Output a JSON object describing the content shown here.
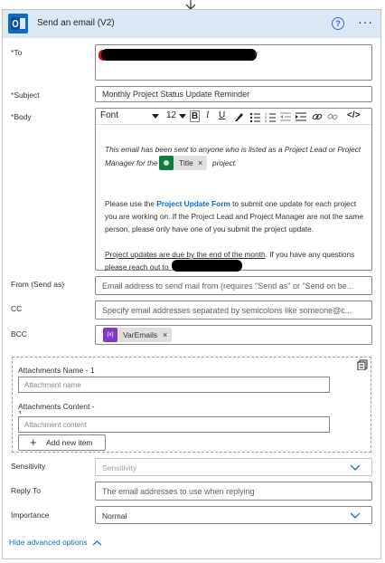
{
  "header": {
    "title": "Send an email (V2)",
    "help_glyph": "?",
    "more_glyph": "···",
    "color": "#dbe9f6",
    "icon": "outlook-icon"
  },
  "fields": {
    "to": {
      "label": "To",
      "value": ""
    },
    "subject": {
      "label": "Subject",
      "value": "Monthly Project Status Update Reminder"
    },
    "body": {
      "label": "Body"
    },
    "from": {
      "label": "From (Send as)",
      "placeholder": "Email address to send mail from (requires \"Send as\" or \"Send on be..."
    },
    "cc": {
      "label": "CC",
      "placeholder": "Specify email addresses separated by semicolons like someone@c..."
    },
    "bcc": {
      "label": "BCC",
      "token": "VarEmails",
      "token_glyph": "{x}"
    },
    "sensitivity": {
      "label": "Sensitivity",
      "placeholder": "Sensitivity"
    },
    "reply_to": {
      "label": "Reply To",
      "placeholder": "The email addresses to use when replying"
    },
    "importance": {
      "label": "Importance",
      "value": "Normal"
    }
  },
  "required_mark": "*",
  "toolbar": {
    "font": "Font",
    "size": "12",
    "bold": "B",
    "italic": "I",
    "underline": "U",
    "code": "</>"
  },
  "body_text": {
    "line1": "This email has been sent to anyone who is listed as a Project Lead or Project",
    "line2_pre": "Manager for the",
    "line2_token": "Title",
    "line2_post": "project.",
    "line3_pre": "Please use the ",
    "line3_link": "Project Update Form",
    "line3_post": " to submit one update for each project",
    "line4": "you are working on.  If the Project Lead and Project Manager are not the same",
    "line5": "person, please only have one of you submit the project update.",
    "line6_underlined": "Project updates are due by the end of the month",
    "line6_post": ".  If you have any questions",
    "line7": "please reach out to"
  },
  "attachments": {
    "name_label": "Attachments Name - 1",
    "name_placeholder": "Attachment name",
    "content_label_1": "Attachments Content -",
    "content_label_2": "1",
    "content_placeholder": "Attachment content",
    "add_label": "Add new item",
    "add_glyph": "+"
  },
  "footer": {
    "advanced_label": "Hide advanced options"
  },
  "token_close": "×",
  "colors": {
    "link": "#0f6cbd",
    "token_purple": "#7e3bbf",
    "token_green": "#107c41",
    "required": "#a4262c"
  }
}
